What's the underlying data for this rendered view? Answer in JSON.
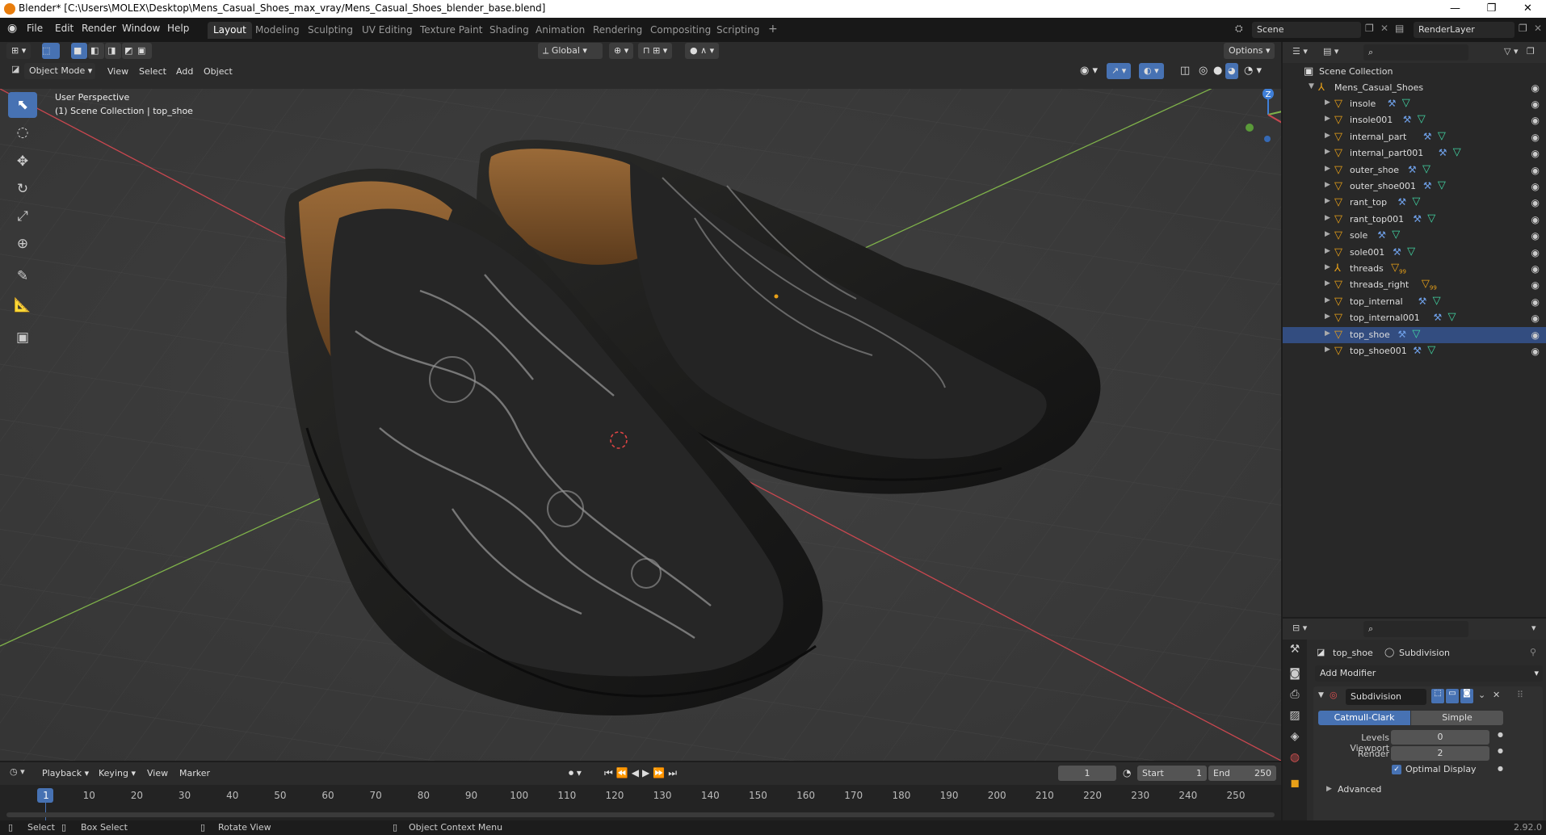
{
  "window": {
    "title": "Blender* [C:\\Users\\MOLEX\\Desktop\\Mens_Casual_Shoes_max_vray/Mens_Casual_Shoes_blender_base.blend]",
    "minimize": "—",
    "maximize": "❐",
    "close": "✕"
  },
  "menu": {
    "items": [
      "File",
      "Edit",
      "Render",
      "Window",
      "Help"
    ],
    "workspaces": [
      "Layout",
      "Modeling",
      "Sculpting",
      "UV Editing",
      "Texture Paint",
      "Shading",
      "Animation",
      "Rendering",
      "Compositing",
      "Scripting"
    ],
    "active_workspace": "Layout",
    "add_tab": "+",
    "scene": "Scene",
    "render_layer": "RenderLayer"
  },
  "viewport_header": {
    "transform_orientation": "Global",
    "options": "Options",
    "mode": "Object Mode",
    "menus": [
      "View",
      "Select",
      "Add",
      "Object"
    ]
  },
  "viewport": {
    "perspective": "User Perspective",
    "collection_info": "(1) Scene Collection | top_shoe",
    "gizmo": {
      "z": "Z",
      "y": "Y",
      "x": "X"
    },
    "colors": {
      "bg": "#3d3d3d",
      "x_axis": "#c8474f",
      "y_axis": "#7fb24a",
      "z_axis": "#3f7fd8",
      "origin": "#e8a018"
    }
  },
  "outliner": {
    "root": "Scene Collection",
    "collection": "Mens_Casual_Shoes",
    "objects": [
      {
        "name": "insole",
        "kind": "mesh"
      },
      {
        "name": "insole001",
        "kind": "mesh"
      },
      {
        "name": "internal_part",
        "kind": "mesh"
      },
      {
        "name": "internal_part001",
        "kind": "mesh"
      },
      {
        "name": "outer_shoe",
        "kind": "mesh"
      },
      {
        "name": "outer_shoe001",
        "kind": "mesh"
      },
      {
        "name": "rant_top",
        "kind": "mesh"
      },
      {
        "name": "rant_top001",
        "kind": "mesh"
      },
      {
        "name": "sole",
        "kind": "mesh"
      },
      {
        "name": "sole001",
        "kind": "mesh"
      },
      {
        "name": "threads",
        "kind": "empty",
        "badge": "99"
      },
      {
        "name": "threads_right",
        "kind": "mesh",
        "badge": "99"
      },
      {
        "name": "top_internal",
        "kind": "mesh"
      },
      {
        "name": "top_internal001",
        "kind": "mesh"
      },
      {
        "name": "top_shoe",
        "kind": "mesh",
        "selected": true
      },
      {
        "name": "top_shoe001",
        "kind": "mesh"
      }
    ]
  },
  "properties": {
    "object": "top_shoe",
    "modifier_context": "Subdivision",
    "add_modifier": "Add Modifier",
    "modifier_name": "Subdivision",
    "type_options": [
      "Catmull-Clark",
      "Simple"
    ],
    "active_type": "Catmull-Clark",
    "levels_viewport_label": "Levels Viewport",
    "levels_viewport": "0",
    "render_label": "Render",
    "render_levels": "2",
    "optimal_display": "Optimal Display",
    "advanced": "Advanced"
  },
  "timeline": {
    "menus": [
      "Playback",
      "Keying",
      "View",
      "Marker"
    ],
    "current_frame": "1",
    "start_label": "Start",
    "start": "1",
    "end_label": "End",
    "end": "250",
    "ticks": [
      "1",
      "10",
      "20",
      "30",
      "40",
      "50",
      "60",
      "70",
      "80",
      "90",
      "100",
      "110",
      "120",
      "130",
      "140",
      "150",
      "160",
      "170",
      "180",
      "190",
      "200",
      "210",
      "220",
      "230",
      "240",
      "250"
    ]
  },
  "status": {
    "select": "Select",
    "box_select": "Box Select",
    "rotate_view": "Rotate View",
    "context_menu": "Object Context Menu",
    "version": "2.92.0"
  }
}
